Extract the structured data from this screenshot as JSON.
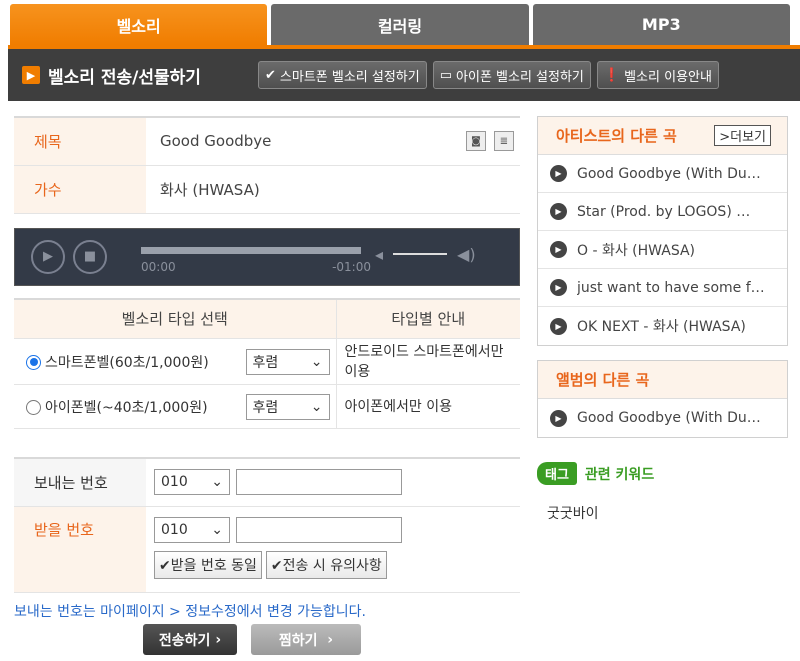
{
  "tabs": [
    "벨소리",
    "컬러링",
    "MP3"
  ],
  "header": {
    "title": "벨소리 전송/선물하기",
    "buttons": [
      "스마트폰 벨소리 설정하기",
      "아이폰 벨소리 설정하기",
      "벨소리 이용안내"
    ]
  },
  "info": {
    "title_label": "제목",
    "title_value": "Good Goodbye",
    "artist_label": "가수",
    "artist_value": "화사 (HWASA)"
  },
  "player": {
    "time_current": "00:00",
    "time_remaining": "-01:00"
  },
  "types": {
    "col_type": "벨소리 타입 선택",
    "col_guide": "타입별 안내",
    "rows": [
      {
        "label": "스마트폰벨(60초/1,000원)",
        "part": "후렴",
        "guide": "안드로이드 스마트폰에서만 이용",
        "selected": true
      },
      {
        "label": "아이폰벨(~40초/1,000원)",
        "part": "후렴",
        "guide": "아이폰에서만 이용",
        "selected": false
      }
    ]
  },
  "send": {
    "from_label": "보내는 번호",
    "from_prefix": "010",
    "to_label": "받을 번호",
    "to_prefix": "010",
    "same_button": "받을 번호 동일",
    "caution_button": "전송 시 유의사항",
    "notice": "보내는 번호는 마이페이지 > 정보수정에서 변경 가능합니다."
  },
  "actions": {
    "send": "전송하기",
    "favorite": "찜하기"
  },
  "artist_songs": {
    "title": "아티스트의 다른 곡",
    "more": "더보기",
    "items": [
      "Good Goodbye (With Du…",
      "Star (Prod. by LOGOS) …",
      "O - 화사 (HWASA)",
      "just want to have some f…",
      "OK NEXT - 화사 (HWASA)"
    ]
  },
  "album_songs": {
    "title": "앨범의 다른 곡",
    "items": [
      "Good Goodbye (With Du…"
    ]
  },
  "tags": {
    "badge": "태그",
    "title": "관련 키워드",
    "keyword": "굿굿바이"
  },
  "colors": {
    "accent": "#f07d00",
    "header_bg": "#3e3e3e",
    "tag_green": "#3a9d23"
  }
}
